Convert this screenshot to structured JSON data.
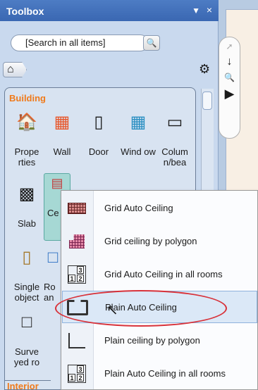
{
  "toolbox": {
    "title": "Toolbox",
    "pin_icon": "↕",
    "close_icon": "×",
    "search_placeholder": "[Search in all items]",
    "search_icon": "search-icon",
    "home_icon": "home-icon",
    "settings_icon": "gear-icon"
  },
  "group": {
    "building_label": "Building",
    "interior_label": "Interior"
  },
  "tiles": [
    {
      "label": "Prope rties",
      "icon": "properties-icon"
    },
    {
      "label": "Wall",
      "icon": "wall-icon"
    },
    {
      "label": "Door",
      "icon": "door-icon"
    },
    {
      "label": "Wind ow",
      "icon": "window-icon"
    },
    {
      "label": "Colum n/bea",
      "icon": "column-icon"
    },
    {
      "label": "Slab",
      "icon": "slab-icon"
    },
    {
      "label": "Ce",
      "icon": "ceiling-icon"
    },
    {
      "label": "Single object",
      "icon": "single-object-icon"
    },
    {
      "label": "Ro an",
      "icon": "room-icon"
    },
    {
      "label": "Surve yed ro",
      "icon": "surveyed-room-icon"
    }
  ],
  "context_menu": {
    "items": [
      {
        "label": "Grid Auto Ceiling",
        "icon": "grid-ceiling-icon"
      },
      {
        "label": "Grid ceiling by polygon",
        "icon": "grid-polygon-icon"
      },
      {
        "label": "Grid Auto Ceiling in all rooms",
        "icon": "grid-all-rooms-icon"
      },
      {
        "label": "Plain Auto Ceiling",
        "icon": "plain-ceiling-icon"
      },
      {
        "label": "Plain ceiling by polygon",
        "icon": "plain-polygon-icon"
      },
      {
        "label": "Plain Auto Ceiling in all rooms",
        "icon": "plain-all-rooms-icon"
      }
    ],
    "highlighted_index": 3
  },
  "side_nav": {
    "icons": [
      "pan-icon",
      "arrow-down-icon",
      "zoom-icon",
      "play-icon"
    ]
  },
  "colors": {
    "title_bar": "#3a67b2",
    "group_label": "#f07a1a",
    "highlight_oval": "#d8323a",
    "selected_tile": "#a6d8d4"
  }
}
